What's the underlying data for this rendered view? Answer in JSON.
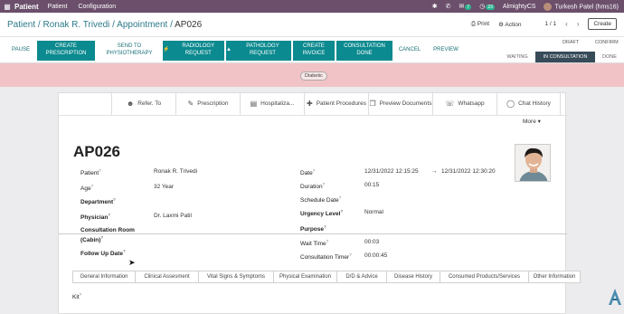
{
  "topnav": {
    "apps_icon": "grid-icon",
    "app_name": "Patient",
    "menu": [
      "Patient",
      "Configuration"
    ],
    "messages_count": "7",
    "activities_count": "23",
    "company": "AlmightyCS",
    "user": "Turkesh Patel (hms16)"
  },
  "breadcrumb": {
    "path": "Patient / Ronak R. Trivedi / Appointment / ",
    "current": "AP026"
  },
  "record_controls": {
    "print": "Print",
    "action": "Action",
    "pager": "1 / 1",
    "create": "Create"
  },
  "actions": {
    "pause": "PAUSE",
    "create_prescription": "CREATE PRESCRIPTION",
    "send_to_physio": "SEND TO PHYSIOTHERAPY",
    "radiology": "RADIOLOGY REQUEST",
    "pathology": "PATHOLOGY REQUEST",
    "create_invoice": "CREATE INVOICE",
    "consultation_done": "CONSULTATION DONE",
    "cancel": "CANCEL",
    "preview": "PREVIEW"
  },
  "stages": {
    "draft": "DRAFT",
    "confirm": "CONFIRM",
    "waiting": "WAITING",
    "in_consultation": "IN CONSULTATION",
    "done": "DONE"
  },
  "ribbon": {
    "tag": "Diabetic"
  },
  "smart_buttons": {
    "refer": "Refer. To",
    "prescription": "Prescription",
    "hospitalization": "Hospitaliza...",
    "procedures": "Patient Procedures",
    "preview_docs": "Preview Documents",
    "whatsapp": "Whatsapp",
    "chat": "Chat History",
    "more": "More"
  },
  "record": {
    "name": "AP026",
    "patient_label": "Patient",
    "patient": "Ronak R. Trivedi",
    "age_label": "Age",
    "age": "32 Year",
    "department_label": "Department",
    "physician_label": "Physician",
    "physician": "Dr. Laxmi Patil",
    "room_label": "Consultation Room (Cabin)",
    "followup_label": "Follow Up Date",
    "date_label": "Date",
    "date_from": "12/31/2022 12:15:25",
    "date_to": "12/31/2022 12:30:20",
    "duration_label": "Duration",
    "duration": "00:15",
    "schedule_label": "Schedule Date",
    "urgency_label": "Urgency Level",
    "urgency": "Normal",
    "purpose_label": "Purpose",
    "wait_label": "Wait Time",
    "wait": "00:03",
    "timer_label": "Consultation Timer",
    "timer": "00:00:45"
  },
  "tabs": [
    "General Information",
    "Clinical Assesment",
    "Vital Signs & Symptoms",
    "Physical Examination",
    "D/D & Advice",
    "Disease History",
    "Consumed Products/Services",
    "Other Information"
  ],
  "kit_label": "Kit",
  "colors": {
    "nav": "#6b4f6b",
    "teal": "#0b8a8f",
    "stage_active": "#374b58",
    "ribbon": "#f1c3c6"
  }
}
